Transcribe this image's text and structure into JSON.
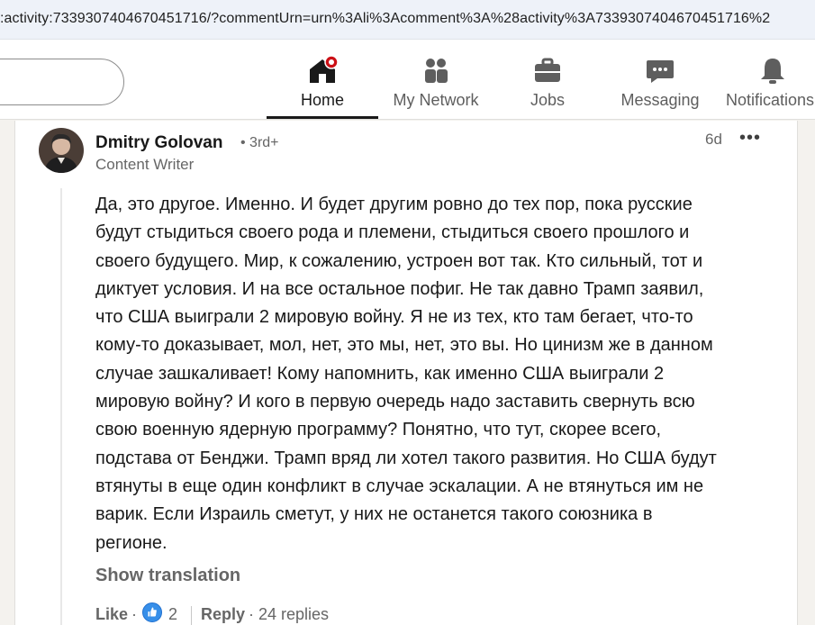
{
  "browser": {
    "url": ":activity:7339307404670451716/?commentUrn=urn%3Ali%3Acomment%3A%28activity%3A7339307404670451716%2"
  },
  "nav": {
    "items": [
      {
        "label": "Home",
        "icon": "home-icon",
        "active": true
      },
      {
        "label": "My Network",
        "icon": "people-icon"
      },
      {
        "label": "Jobs",
        "icon": "briefcase-icon"
      },
      {
        "label": "Messaging",
        "icon": "chat-icon"
      },
      {
        "label": "Notifications",
        "icon": "bell-icon"
      }
    ]
  },
  "comment": {
    "author": "Dmitry Golovan",
    "degree": "• 3rd+",
    "headline": "Content Writer",
    "time": "6d",
    "more": "•••",
    "lines": [
      "Да, это другое. Именно. И будет другим ровно до тех пор, пока русские",
      "будут стыдиться своего рода и племени, стыдиться своего прошлого и",
      "своего будущего. Мир, к сожалению, устроен вот так. Кто сильный, тот и",
      "диктует условия. И на все остальное пофиг. Не так давно Трамп заявил,",
      "что США выиграли 2 мировую войну. Я не из тех, кто там бегает, что-то",
      "кому-то доказывает, мол, нет, это мы, нет, это вы. Но цинизм же в данном",
      "случае зашкаливает! Кому напомнить, как именно США выиграли 2",
      "мировую войну? И кого в первую очередь надо заставить свернуть всю",
      "свою военную ядерную программу? Понятно, что тут, скорее всего,",
      "подстава от Бенджи. Трамп вряд ли хотел такого развития. Но США будут",
      "втянуты в еще один конфликт в случае эскалации. А не втянуться им не",
      "варик. Если Израиль сметут, у них не останется такого союзника в",
      "регионе."
    ],
    "show_translation": "Show translation",
    "like_label": "Like",
    "separator": "·",
    "like_count": "2",
    "reply_label": "Reply",
    "replies": "24 replies"
  },
  "colors": {
    "accent": "#378fe9",
    "notification": "#cc1016",
    "text_muted": "#666666"
  }
}
